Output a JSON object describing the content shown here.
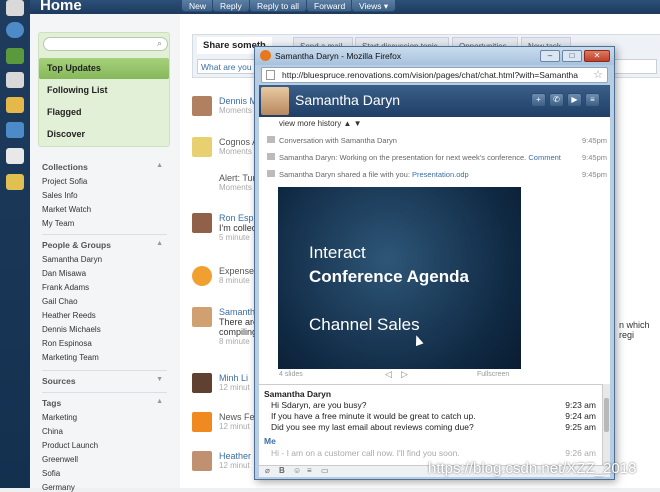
{
  "topbar": {
    "title": "Home",
    "buttons": [
      "New",
      "Reply",
      "Reply to all",
      "Forward",
      "Views ▾"
    ]
  },
  "leftpanel": {
    "filters": [
      "Top Updates",
      "Following List",
      "Flagged",
      "Discover"
    ],
    "collections": {
      "heading": "Collections",
      "items": [
        "Project Sofia",
        "Sales Info",
        "Market Watch",
        "My Team"
      ]
    },
    "people": {
      "heading": "People & Groups",
      "items": [
        "Samantha Daryn",
        "Dan Misawa",
        "Frank Adams",
        "Gail Chao",
        "Heather Reeds",
        "Dennis Michaels",
        "Ron Espinosa",
        "Marketing Team"
      ]
    },
    "sources": {
      "heading": "Sources"
    },
    "tags": {
      "heading": "Tags",
      "items": [
        "Marketing",
        "China",
        "Product Launch",
        "Greenwell",
        "Sofia",
        "Germany"
      ]
    }
  },
  "main": {
    "tabs": [
      "Share someth",
      "Send a mail",
      "Start discussion topic",
      "Opportunities",
      "New task"
    ],
    "share_prompt": "What are you w",
    "feed": [
      {
        "name": "Dennis M",
        "sub": "Moments"
      },
      {
        "name": "Cognos A",
        "sub": "Moments"
      },
      {
        "name": "Alert: Tur",
        "sub": "Moments"
      },
      {
        "name": "Ron Espi",
        "text": "I'm collec",
        "sub": "5 minute"
      },
      {
        "name": "Expense",
        "sub": "8 minute"
      },
      {
        "name": "Samanth",
        "text": "There are",
        "text2": "compiling",
        "sub": "8 minute",
        "trailing": "n which regi"
      },
      {
        "name": "Minh Li",
        "sub": "12 minut"
      },
      {
        "name": "News Fe",
        "sub": "12 minut"
      },
      {
        "name": "Heather F",
        "sub": "12 minut"
      }
    ]
  },
  "firefox": {
    "title": "Samantha Daryn - Mozilla Firefox",
    "url": "http://bluespruce.renovations.com/vision/pages/chat/chat.html?with=Samantha",
    "contact": "Samantha Daryn",
    "history_link": "view more history ▲ ▼",
    "system_lines": [
      {
        "text": "Conversation with Samantha Daryn",
        "time": "9:45pm"
      },
      {
        "text": "Samantha Daryn: Working on the presentation for next week's conference.",
        "link": "Comment",
        "time": "9:45pm"
      },
      {
        "text": "Samantha Daryn shared a file with you:",
        "link": "Presentation.odp",
        "time": "9:45pm"
      }
    ],
    "slide": {
      "line1": "Interact",
      "line2": "Conference Agenda",
      "line3": "Channel Sales",
      "count": "4 slides",
      "fullscreen": "Fullscreen"
    },
    "chat": {
      "sender": "Samantha Daryn",
      "messages": [
        {
          "text": "Hi Sdaryn, are you busy?",
          "time": "9:23 am"
        },
        {
          "text": "If you have a free minute it would be great to catch up.",
          "time": "9:24 am"
        },
        {
          "text": "Did you see my last email about reviews coming due?",
          "time": "9:25 am"
        }
      ],
      "me": "Me",
      "draft": "Hi - I am on a customer call now. I'll find you soon.",
      "draft_time": "9:26 am"
    }
  },
  "watermark": "https://blog.csdn.net/XZZ_2018",
  "colors": {
    "accent_green": "#8fc064",
    "header_blue": "#1f3c5e",
    "link_blue": "#3a6ea5"
  }
}
